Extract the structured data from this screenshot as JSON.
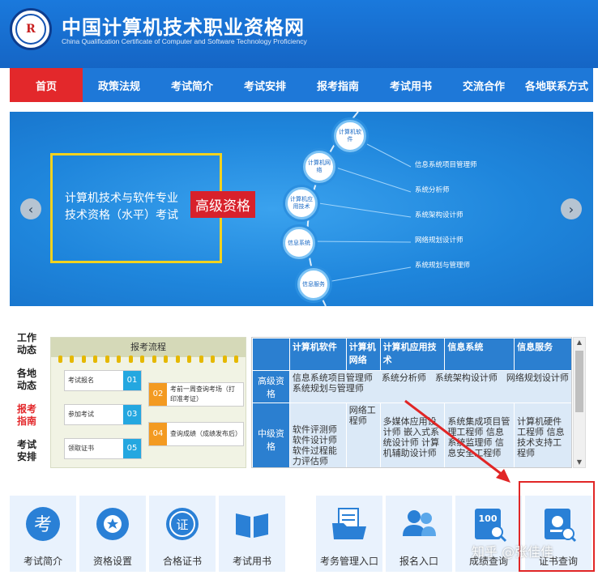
{
  "header": {
    "title": "中国计算机技术职业资格网",
    "subtitle": "China Qualification Certificate of Computer and Software Technology Proficiency",
    "logo_text": "R"
  },
  "nav": {
    "items": [
      {
        "label": "首页",
        "active": true
      },
      {
        "label": "政策法规"
      },
      {
        "label": "考试简介"
      },
      {
        "label": "考试安排"
      },
      {
        "label": "报考指南"
      },
      {
        "label": "考试用书"
      },
      {
        "label": "交流合作"
      },
      {
        "label": "各地联系方式"
      }
    ]
  },
  "banner": {
    "line1": "计算机技术与软件专业",
    "line2": "技术资格（水平）考试",
    "badge": "高级资格",
    "circles": [
      "计算机软件",
      "计算机网络",
      "计算机应用技术",
      "信息系统",
      "信息服务"
    ],
    "right_list": [
      "信息系统项目管理师",
      "系统分析师",
      "系统架构设计师",
      "网络规划设计师",
      "系统规划与管理师"
    ],
    "prev_arrow": "‹",
    "next_arrow": "›"
  },
  "side_tabs": [
    {
      "label": "工作动态"
    },
    {
      "label": "各地动态"
    },
    {
      "label": "报考指南",
      "active": true
    },
    {
      "label": "考试安排"
    }
  ],
  "flow": {
    "title": "报考流程",
    "steps": [
      {
        "text": "考试报名",
        "num": "01"
      },
      {
        "text": "考前一周查询考场（打印准考证）",
        "num": "02"
      },
      {
        "text": "参加考试",
        "num": "03"
      },
      {
        "text": "查询成绩（成绩发布后）",
        "num": "04"
      },
      {
        "text": "领取证书",
        "num": "05"
      }
    ]
  },
  "table": {
    "headers": [
      "计算机软件",
      "计算机网络",
      "计算机应用技术",
      "信息系统",
      "信息服务"
    ],
    "rows": [
      {
        "level": "高级资格",
        "merged": "信息系统项目管理师　系统分析师　系统架构设计师　网络规划设计师　系统规划与管理师"
      },
      {
        "level": "中级资格",
        "cells": [
          "软件评测师 软件设计师 软件过程能力评估师",
          "网络工程师",
          "多媒体应用设计师 嵌入式系统设计师 计算机辅助设计师",
          "系统集成项目管理工程师 信息系统监理师 信息安全工程师",
          "计算机硬件工程师 信息技术支持工程师"
        ]
      }
    ]
  },
  "tiles": [
    {
      "label": "考试简介",
      "icon": "exam-character-icon"
    },
    {
      "label": "资格设置",
      "icon": "medal-icon"
    },
    {
      "label": "合格证书",
      "icon": "certificate-seal-icon"
    },
    {
      "label": "考试用书",
      "icon": "open-book-icon"
    },
    {
      "label": "考务管理入口",
      "icon": "folder-document-icon"
    },
    {
      "label": "报名入口",
      "icon": "users-icon"
    },
    {
      "label": "成绩查询",
      "icon": "score-100-search-icon"
    },
    {
      "label": "证书查询",
      "icon": "certificate-search-icon"
    }
  ],
  "watermark": "知乎 @张佳佳",
  "colors": {
    "header_blue": "#1a79dc",
    "nav_active_red": "#e3282b",
    "annotation_red": "#e12626"
  }
}
